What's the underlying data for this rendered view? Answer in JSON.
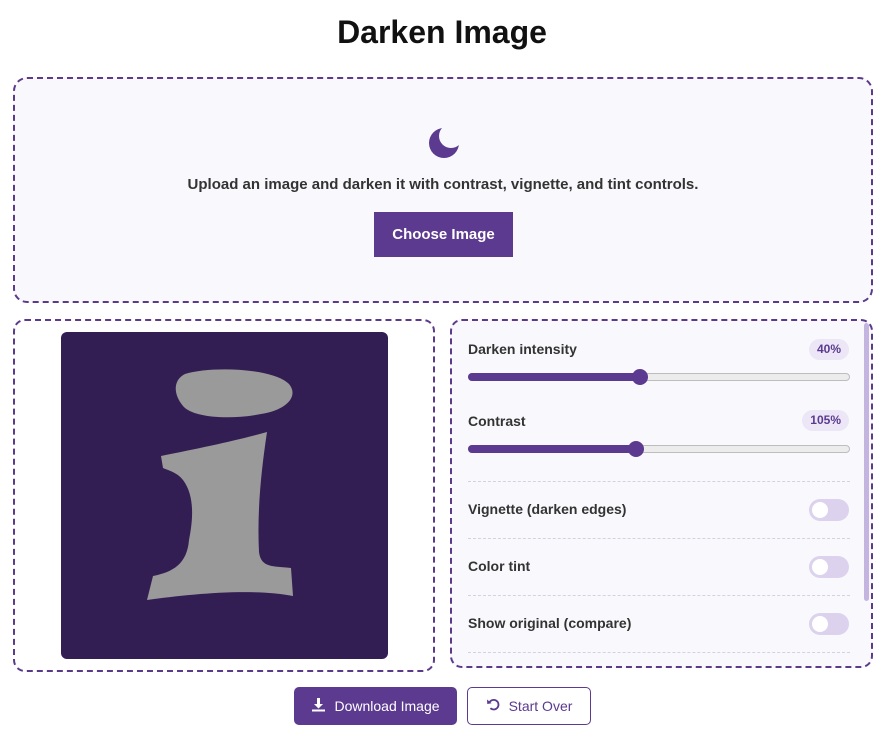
{
  "page": {
    "title": "Darken Image"
  },
  "upload": {
    "icon": "moon-icon",
    "description": "Upload an image and darken it with contrast, vignette, and tint controls.",
    "choose_label": "Choose Image"
  },
  "preview": {
    "background_color": "#321e53",
    "glyph_color": "#9a9a9a"
  },
  "controls": {
    "darken": {
      "label": "Darken intensity",
      "value_label": "40%",
      "fraction": 0.45
    },
    "contrast": {
      "label": "Contrast",
      "value_label": "105%",
      "fraction": 0.44
    },
    "toggles": [
      {
        "label": "Vignette (darken edges)",
        "on": false
      },
      {
        "label": "Color tint",
        "on": false
      },
      {
        "label": "Show original (compare)",
        "on": false
      }
    ]
  },
  "actions": {
    "download_label": "Download Image",
    "start_over_label": "Start Over"
  },
  "colors": {
    "accent": "#5b3a8f",
    "toggle_off": "#dcd2ee",
    "badge_bg": "#ece6f6"
  }
}
